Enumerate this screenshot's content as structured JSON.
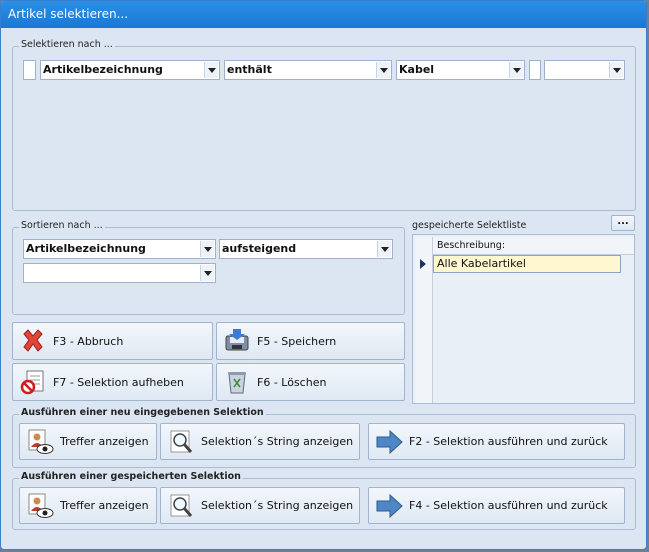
{
  "window": {
    "title": "Artikel selektieren..."
  },
  "select_group": {
    "title": "Selektieren nach ...",
    "field": "Artikelbezeichnung",
    "operator": "enthält",
    "value": "Kabel",
    "extra": ""
  },
  "sort_group": {
    "title": "Sortieren nach ...",
    "field": "Artikelbezeichnung",
    "direction": "aufsteigend",
    "field2": ""
  },
  "saved_list": {
    "label": "gespeicherte Selektliste",
    "more_label": "...",
    "column_header": "Beschreibung:",
    "rows": [
      "Alle Kabelartikel"
    ]
  },
  "actions": {
    "cancel": "F3 - Abbruch",
    "save": "F5 - Speichern",
    "clear": "F7 - Selektion aufheben",
    "delete": "F6 - Löschen"
  },
  "new_selection": {
    "title": "Ausführen einer neu eingegebenen Selektion",
    "show_hits": "Treffer anzeigen",
    "show_string": "Selektion´s String anzeigen",
    "execute": "F2 - Selektion ausführen und zurück"
  },
  "saved_selection": {
    "title": "Ausführen einer gespeicherten Selektion",
    "show_hits": "Treffer anzeigen",
    "show_string": "Selektion´s String anzeigen",
    "execute": "F4 - Selektion ausführen und zurück"
  },
  "colors": {
    "title_bar": "#1a78d4",
    "window_bg": "#dce6f2",
    "selected_row": "#fff7cf"
  }
}
